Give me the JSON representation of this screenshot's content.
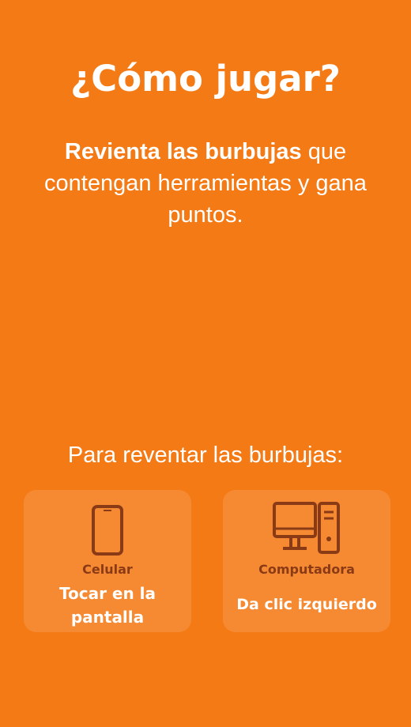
{
  "title": "¿Cómo jugar?",
  "intro": {
    "bold": "Revienta las burbujas",
    "rest": " que contengan herramientas y gana puntos."
  },
  "instructions": "Para reventar las burbujas:",
  "cards": [
    {
      "device": "Celular",
      "action": "Tocar en la pantalla",
      "icon": "smartphone-icon"
    },
    {
      "device": "Computadora",
      "action": "Da clic izquierdo",
      "icon": "desktop-computer-icon"
    }
  ],
  "colors": {
    "background": "#F47A16",
    "card": "#F68A33",
    "icon_and_label": "#8B3A16",
    "text": "#FFFFFF"
  }
}
